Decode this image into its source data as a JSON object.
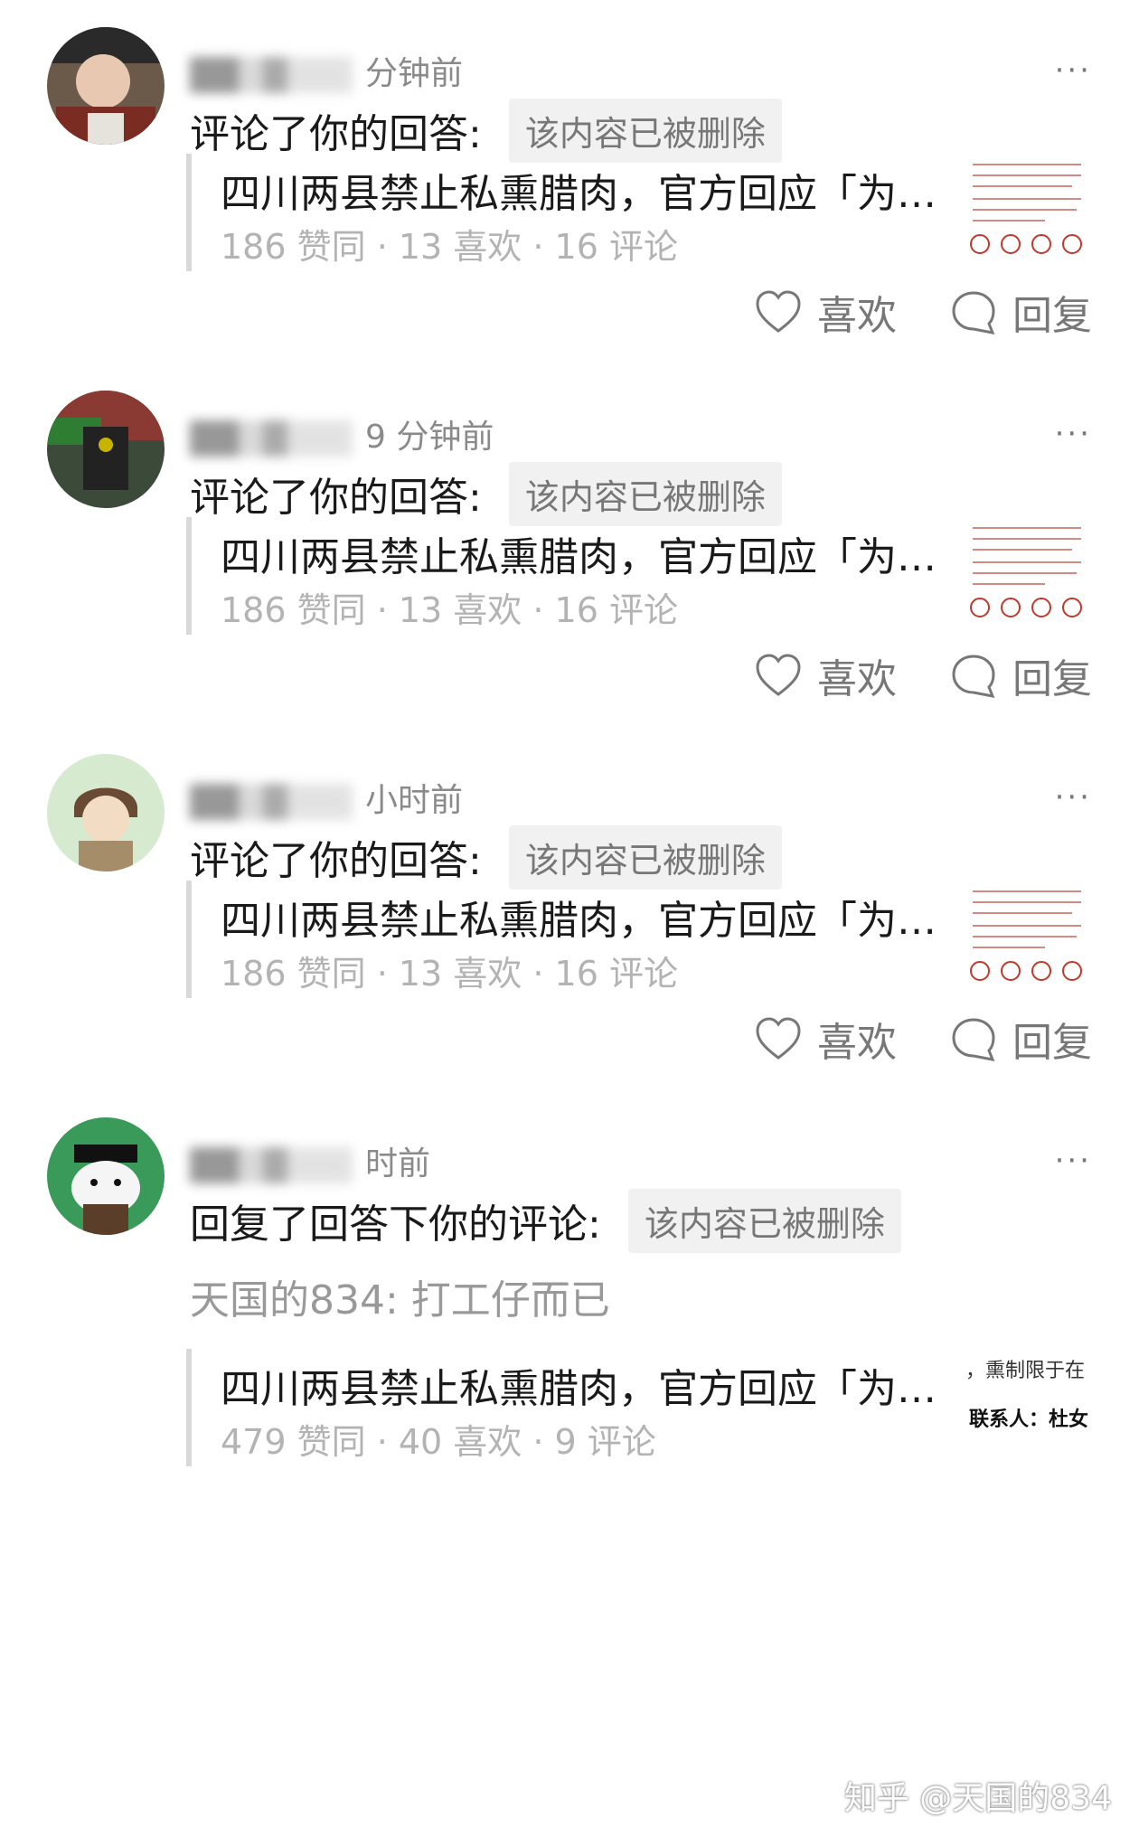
{
  "cards": [
    {
      "time_text": "分钟前",
      "action": "评论了你的回答:",
      "deleted_tag": "该内容已被删除",
      "ref_title": "四川两县禁止私熏腊肉，官方回应「为…",
      "ref_stats": "186 赞同 · 13 喜欢 · 16 评论",
      "like_label": "喜欢",
      "reply_label": "回复",
      "more": "···"
    },
    {
      "time_text": "9 分钟前",
      "action": "评论了你的回答:",
      "deleted_tag": "该内容已被删除",
      "ref_title": "四川两县禁止私熏腊肉，官方回应「为…",
      "ref_stats": "186 赞同 · 13 喜欢 · 16 评论",
      "like_label": "喜欢",
      "reply_label": "回复",
      "more": "···"
    },
    {
      "time_text": "小时前",
      "action": "评论了你的回答:",
      "deleted_tag": "该内容已被删除",
      "ref_title": "四川两县禁止私熏腊肉，官方回应「为…",
      "ref_stats": "186 赞同 · 13 喜欢 · 16 评论",
      "like_label": "喜欢",
      "reply_label": "回复",
      "more": "···"
    },
    {
      "time_text": "时前",
      "action": "回复了回答下你的评论:",
      "deleted_tag": "该内容已被删除",
      "quote": "天国的834: 打工仔而已",
      "ref_title": "四川两县禁止私熏腊肉，官方回应「为…",
      "ref_stats": "479 赞同 · 40 喜欢 · 9 评论",
      "more": "···",
      "thumb_text_1": "，熏制限于在",
      "thumb_text_2": "联系人：杜女"
    }
  ],
  "watermark": "知乎 @天国的834",
  "colors": {
    "text": "#1a1a1a",
    "muted": "#999999",
    "stats": "#b3b3b3",
    "tag_bg": "#f1f1f1",
    "quote_bar": "#d9d9d9"
  },
  "icons": {
    "like": "heart-icon",
    "reply": "speech-bubble-icon",
    "more": "more-dots-icon"
  }
}
